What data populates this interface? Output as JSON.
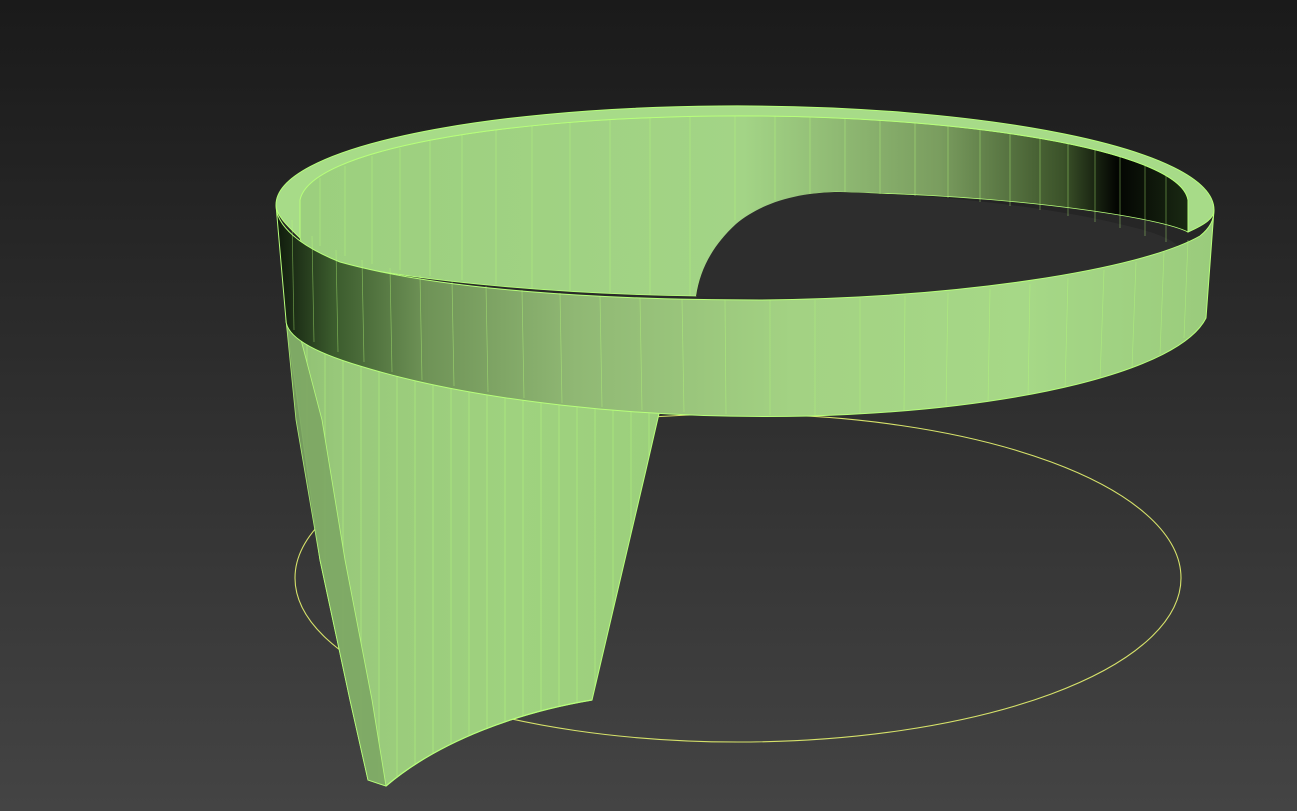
{
  "viewport": {
    "background_top": "#1a1a1a",
    "background_bottom": "#444444"
  },
  "model": {
    "object": "extruded-ring-with-spiral-sweep",
    "base_color": "#9fd67f",
    "edge_color": "#b7ff7a",
    "dark_color": "#0d1608"
  },
  "helper": {
    "object": "circle-spline",
    "color": "#d6e26a"
  }
}
